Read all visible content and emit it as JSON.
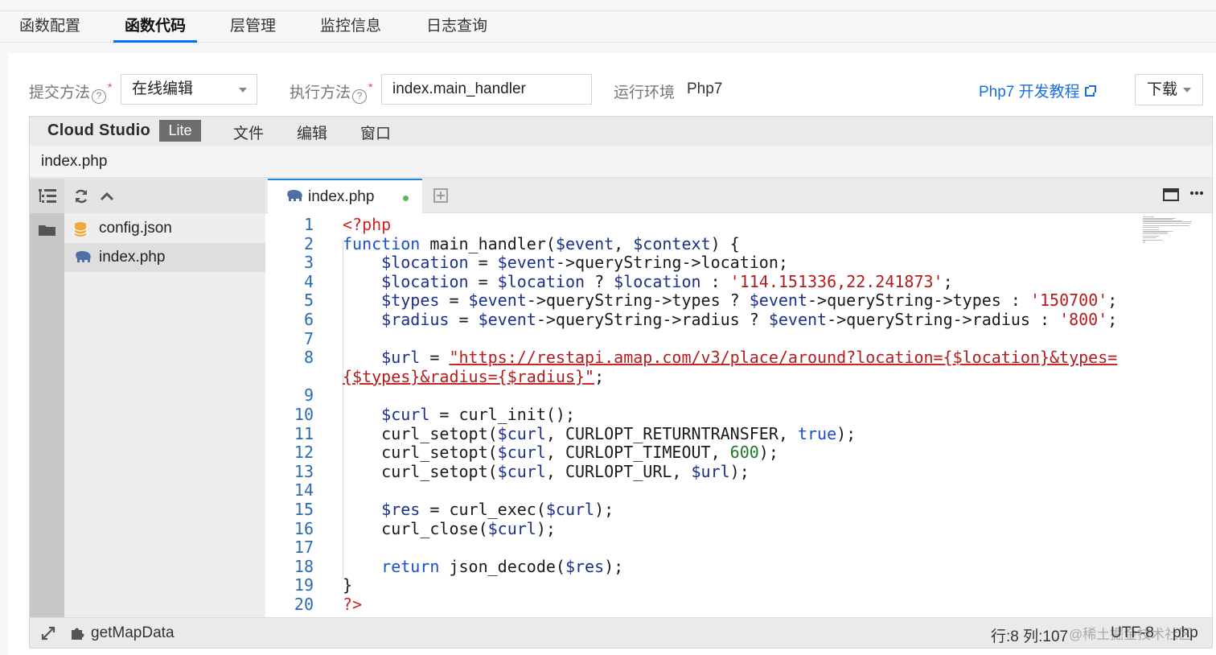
{
  "tabs": [
    "函数配置",
    "函数代码",
    "层管理",
    "监控信息",
    "日志查询"
  ],
  "active_tab": "函数代码",
  "form": {
    "submit_label": "提交方法",
    "submit_value": "在线编辑",
    "exec_label": "执行方法",
    "exec_value": "index.main_handler",
    "env_label": "运行环境",
    "env_value": "Php7",
    "tutorial_link": "Php7 开发教程",
    "download_label": "下载",
    "help_glyph": "?",
    "required_mark": "*"
  },
  "ide": {
    "brand": "Cloud Studio",
    "brand_badge": "Lite",
    "menus": [
      "文件",
      "编辑",
      "窗口"
    ],
    "breadcrumb": "index.php",
    "files": [
      {
        "name": "config.json",
        "icon": "database-icon"
      },
      {
        "name": "index.php",
        "icon": "php-elephant-icon"
      }
    ],
    "open_tab": "index.php",
    "status": {
      "task": "getMapData",
      "position": "行:8 列:107",
      "watermark": "@稀土掘金技术社区",
      "encoding": "UTF-8",
      "language": "php"
    }
  },
  "code_lines": [
    {
      "n": "1",
      "t": "<?php"
    },
    {
      "n": "2",
      "t": "function main_handler($event, $context) {"
    },
    {
      "n": "3",
      "t": "    $location = $event->queryString->location;"
    },
    {
      "n": "4",
      "t": "    $location = $location ? $location : '114.151336,22.241873';"
    },
    {
      "n": "5",
      "t": "    $types = $event->queryString->types ? $event->queryString->types : '150700';"
    },
    {
      "n": "6",
      "t": "    $radius = $event->queryString->radius ? $event->queryString->radius : '800';"
    },
    {
      "n": "7",
      "t": ""
    },
    {
      "n": "8",
      "t": "    $url = \"https://restapi.amap.com/v3/place/around?location={$location}&types="
    },
    {
      "n": "",
      "t": "{$types}&radius={$radius}\";"
    },
    {
      "n": "9",
      "t": ""
    },
    {
      "n": "10",
      "t": "    $curl = curl_init();"
    },
    {
      "n": "11",
      "t": "    curl_setopt($curl, CURLOPT_RETURNTRANSFER, true);"
    },
    {
      "n": "12",
      "t": "    curl_setopt($curl, CURLOPT_TIMEOUT, 600);"
    },
    {
      "n": "13",
      "t": "    curl_setopt($curl, CURLOPT_URL, $url);"
    },
    {
      "n": "14",
      "t": ""
    },
    {
      "n": "15",
      "t": "    $res = curl_exec($curl);"
    },
    {
      "n": "16",
      "t": "    curl_close($curl);"
    },
    {
      "n": "17",
      "t": ""
    },
    {
      "n": "18",
      "t": "    return json_decode($res);"
    },
    {
      "n": "19",
      "t": "}"
    },
    {
      "n": "20",
      "t": "?>"
    }
  ]
}
